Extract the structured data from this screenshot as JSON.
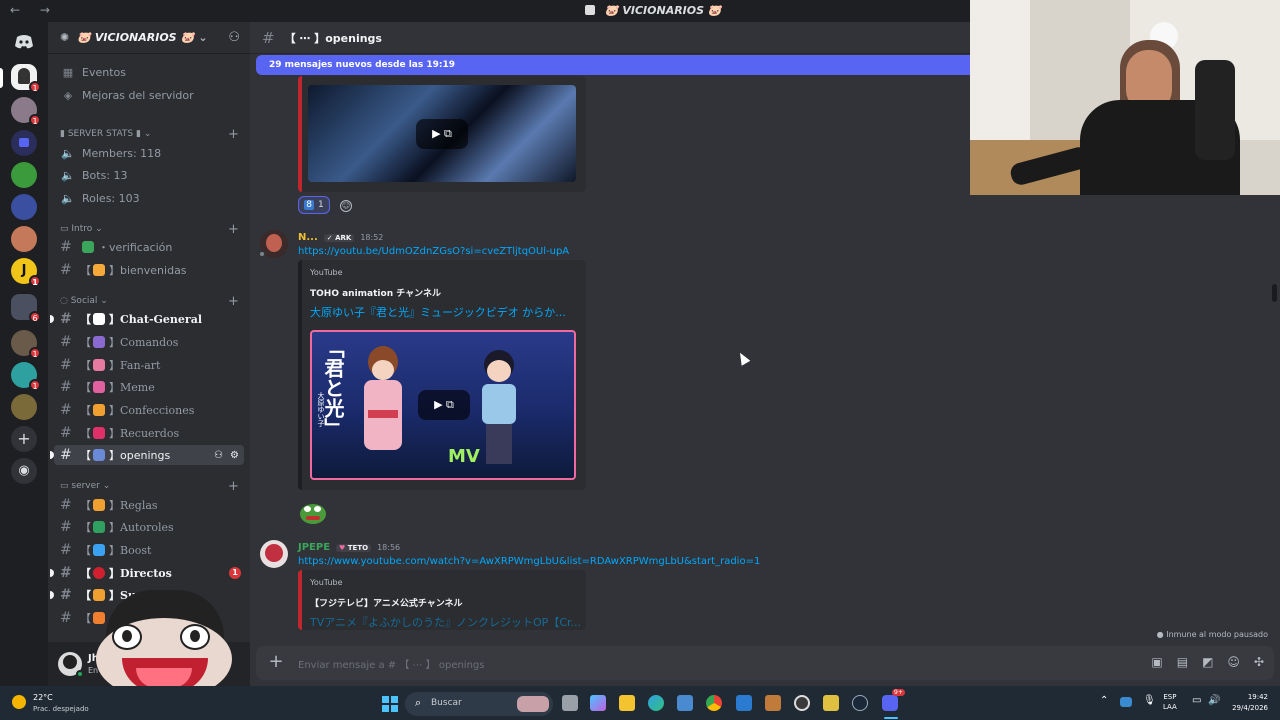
{
  "window": {
    "title": "VICIONARIOS",
    "nav": "← →"
  },
  "server": {
    "name": "VICIONARIOS"
  },
  "sidebar": {
    "top_items": [
      {
        "label": "Eventos",
        "icon": "calendar-icon"
      },
      {
        "label": "Mejoras del servidor",
        "icon": "boost-icon"
      }
    ],
    "categories": {
      "stats": "SERVER STATS",
      "intro": "Intro",
      "social": "Social",
      "server": "server"
    },
    "stats": [
      "Members: 118",
      "Bots: 13",
      "Roles: 103"
    ],
    "intro_channels": [
      "verificación",
      "bienvenidas"
    ],
    "social_channels": [
      "Chat-General",
      "Comandos",
      "Fan-art",
      "Meme",
      "Confecciones",
      "Recuerdos",
      "openings"
    ],
    "server_channels": [
      "Reglas",
      "Autoroles",
      "Boost",
      "Directos",
      "Su...",
      "..."
    ],
    "directos_badge": "1",
    "brackets": {
      "open": "【",
      "close": "】"
    }
  },
  "user": {
    "name": "Jhony",
    "status": "En línea"
  },
  "channel": {
    "name": "【 ⋯ 】openings",
    "hash": "#"
  },
  "new_messages_bar": "29 mensajes nuevos desde las 19:19",
  "reactions": {
    "count_a": "8",
    "count_b": "1"
  },
  "messages": [
    {
      "author": "N...",
      "tag": "ARK",
      "time": "18:52",
      "link": "https://youtu.be/UdmOZdnZGsO?si=cveZTljtqOUl-upA",
      "embed_provider": "YouTube",
      "embed_author": "TOHO animation チャンネル",
      "embed_title": "大原ゆい子『君と光』ミュージックビデオ からか...",
      "thumb_text": "「君と光」",
      "thumb_sub": "大原ゆい子",
      "thumb_mv": "MV"
    },
    {
      "author": "JPEPE",
      "tag": "TETO",
      "time": "18:56",
      "link": "https://www.youtube.com/watch?v=AwXRPWmgLbU&list=RDAwXRPWmgLbU&start_radio=1",
      "embed_provider": "YouTube",
      "embed_author": "【フジテレビ】アニメ公式チャンネル",
      "embed_title": "TVアニメ『よふかしのうた』ノンクレジットOP【Cr..."
    }
  ],
  "composer": {
    "placeholder": "Enviar mensaje a # 【 ⋯ 】 openings"
  },
  "pause_notice": "Inmune al modo pausado",
  "taskbar": {
    "weather_temp": "22°C",
    "weather_desc": "Prac. despejado",
    "search": "Buscar",
    "lang": "ESP",
    "lang_sub": "LAA",
    "time": "19:42",
    "date": "29/4/2026",
    "discord_badge": "9+"
  },
  "colors": {
    "accent": "#5865f2",
    "link": "#00a8fc",
    "green_name": "#3ba55c",
    "red_embed": "#c0262d"
  }
}
